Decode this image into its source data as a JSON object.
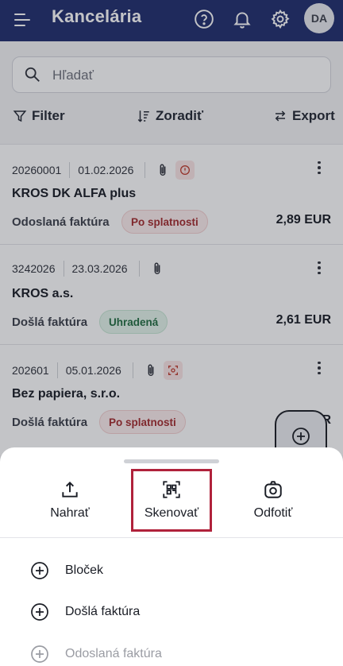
{
  "header": {
    "title": "Kancelária",
    "avatar_initials": "DA",
    "icons": [
      "menu-icon",
      "help-icon",
      "bell-icon",
      "gear-icon"
    ]
  },
  "search": {
    "placeholder": "Hľadať"
  },
  "toolbar": {
    "filter_label": "Filter",
    "sort_label": "Zoradiť",
    "export_label": "Export"
  },
  "invoices": [
    {
      "number": "20260001",
      "date": "01.02.2026",
      "name": "KROS DK ALFA plus",
      "type": "Odoslaná faktúra",
      "status": "Po splatnosti",
      "amount": "2,89 EUR"
    },
    {
      "number": "3242026",
      "date": "23.03.2026",
      "name": "KROS a.s.",
      "type": "Došlá faktúra",
      "status": "Uhradená",
      "amount": "2,61 EUR"
    },
    {
      "number": "202601",
      "date": "05.01.2026",
      "name": "Bez papiera, s.r.o.",
      "type": "Došlá faktúra",
      "status": "Po splatnosti",
      "amount": "R"
    }
  ],
  "sheet": {
    "actions": [
      {
        "label": "Nahrať",
        "icon": "upload-icon"
      },
      {
        "label": "Skenovať",
        "icon": "scan-icon"
      },
      {
        "label": "Odfotiť",
        "icon": "camera-icon"
      }
    ],
    "items": [
      {
        "label": "Bloček",
        "icon": "plus-circle-icon"
      },
      {
        "label": "Došlá faktúra",
        "icon": "plus-circle-icon"
      },
      {
        "label": "Odoslaná faktúra",
        "icon": "plus-circle-icon"
      }
    ]
  },
  "colors": {
    "header_bg": "#1c2a6b",
    "highlight": "#b0223b",
    "status_due": "#a2272a",
    "status_paid": "#1e6b3e"
  }
}
